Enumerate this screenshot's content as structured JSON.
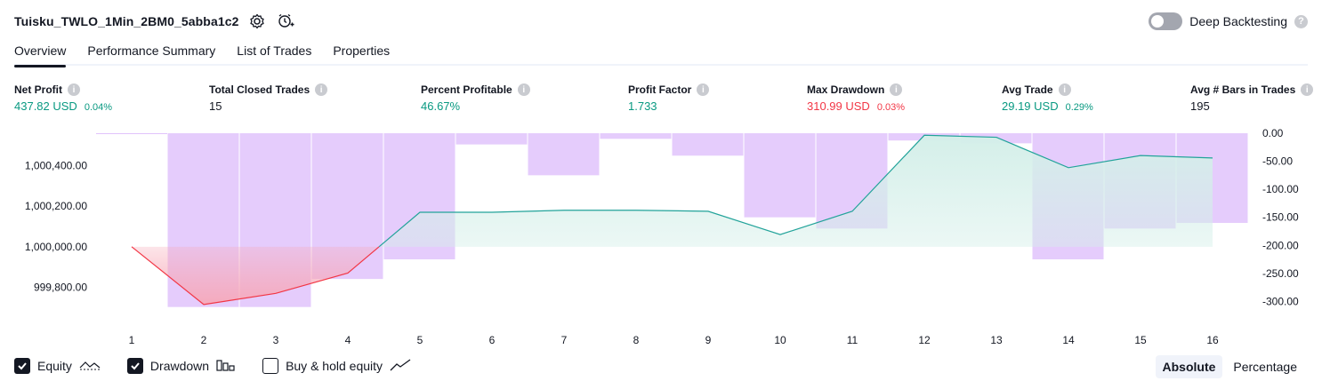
{
  "header": {
    "strategy_name": "Tuisku_TWLO_1Min_2BM0_5abba1c2",
    "icons": [
      "settings-icon",
      "add-alert-icon"
    ]
  },
  "deep_backtesting": {
    "label": "Deep Backtesting",
    "enabled": false
  },
  "tabs": [
    {
      "label": "Overview",
      "active": true
    },
    {
      "label": "Performance Summary",
      "active": false
    },
    {
      "label": "List of Trades",
      "active": false
    },
    {
      "label": "Properties",
      "active": false
    }
  ],
  "metrics": {
    "net_profit": {
      "label": "Net Profit",
      "value": "437.82 USD",
      "pct": "0.04%"
    },
    "total_closed_trades": {
      "label": "Total Closed Trades",
      "value": "15"
    },
    "percent_profitable": {
      "label": "Percent Profitable",
      "value": "46.67%"
    },
    "profit_factor": {
      "label": "Profit Factor",
      "value": "1.733"
    },
    "max_drawdown": {
      "label": "Max Drawdown",
      "value": "310.99 USD",
      "pct": "0.03%"
    },
    "avg_trade": {
      "label": "Avg Trade",
      "value": "29.19 USD",
      "pct": "0.29%"
    },
    "avg_bars": {
      "label": "Avg # Bars in Trades",
      "value": "195"
    }
  },
  "colors": {
    "equity_line": "#22a39a",
    "equity_fill": "#d4efe9",
    "equity_loss_line": "#f23645",
    "equity_loss_fill": "#f7a7b6",
    "drawdown_bar": "#e1c3fb",
    "positive": "#089981",
    "negative": "#f23645"
  },
  "chart_data": {
    "type": "line",
    "categories": [
      "1",
      "2",
      "3",
      "4",
      "5",
      "6",
      "7",
      "8",
      "9",
      "10",
      "11",
      "12",
      "13",
      "14",
      "15",
      "16"
    ],
    "series": [
      {
        "values": [
          1000000,
          999715,
          999770,
          999870,
          1000170,
          1000170,
          1000180,
          1000180,
          1000175,
          1000060,
          1000175,
          1000550,
          1000540,
          1000390,
          1000450,
          1000438
        ]
      },
      {
        "values": [
          0,
          -310,
          -310,
          -260,
          -225,
          -20,
          -75,
          -10,
          -40,
          -150,
          -170,
          -13,
          -18,
          -225,
          -170,
          -160
        ]
      }
    ],
    "left_axis": {
      "ticks": [
        "1,000,400.00",
        "1,000,200.00",
        "1,000,000.00",
        "999,800.00"
      ],
      "ylim": [
        999675,
        1000560
      ]
    },
    "right_axis": {
      "ticks": [
        "0.00",
        "-50.00",
        "-100.00",
        "-150.00",
        "-200.00",
        "-250.00",
        "-300.00"
      ],
      "ylim": [
        -320,
        0
      ]
    },
    "grid": false
  },
  "legend": [
    {
      "label": "Equity",
      "checked": true,
      "icon": "equity-line-icon"
    },
    {
      "label": "Drawdown",
      "checked": true,
      "icon": "drawdown-bars-icon"
    },
    {
      "label": "Buy & hold equity",
      "checked": false,
      "icon": "buy-hold-line-icon"
    }
  ],
  "display_modes": [
    {
      "label": "Absolute",
      "active": true
    },
    {
      "label": "Percentage",
      "active": false
    }
  ]
}
